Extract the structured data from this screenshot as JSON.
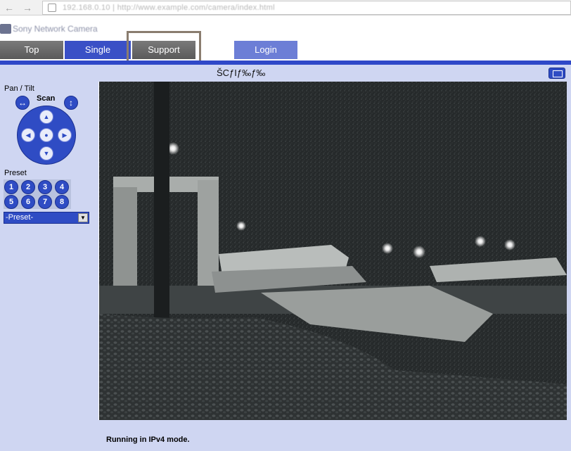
{
  "browser": {
    "back_icon": "back-arrow-icon",
    "forward_icon": "forward-arrow-icon",
    "url": "192.168.0.10 | http://www.example.com/camera/index.html"
  },
  "brand": {
    "name": "Sony Network Camera"
  },
  "tabs": {
    "top": "Top",
    "single": "Single",
    "support": "Support",
    "login": "Login"
  },
  "camera": {
    "title": "ŠCƒIƒ‰ƒ‰"
  },
  "controls": {
    "pan_tilt_label": "Pan / Tilt",
    "scan_label": "Scan",
    "scan_horizontal_icon": "↔",
    "scan_vertical_icon": "↕",
    "dpad": {
      "up": "▲",
      "left": "◀",
      "home": "●",
      "right": "▶",
      "down": "▼"
    },
    "preset_label": "Preset",
    "presets": [
      "1",
      "2",
      "3",
      "4",
      "5",
      "6",
      "7",
      "8"
    ],
    "preset_select_value": "-Preset-"
  },
  "status": {
    "text": "Running in IPv4 mode."
  },
  "colors": {
    "accent": "#2f48c8",
    "panel": "#cfd6f2",
    "tab_active": "#3a50c6",
    "tab_inactive": "#666666",
    "highlight_frame": "#8a7d6f"
  }
}
